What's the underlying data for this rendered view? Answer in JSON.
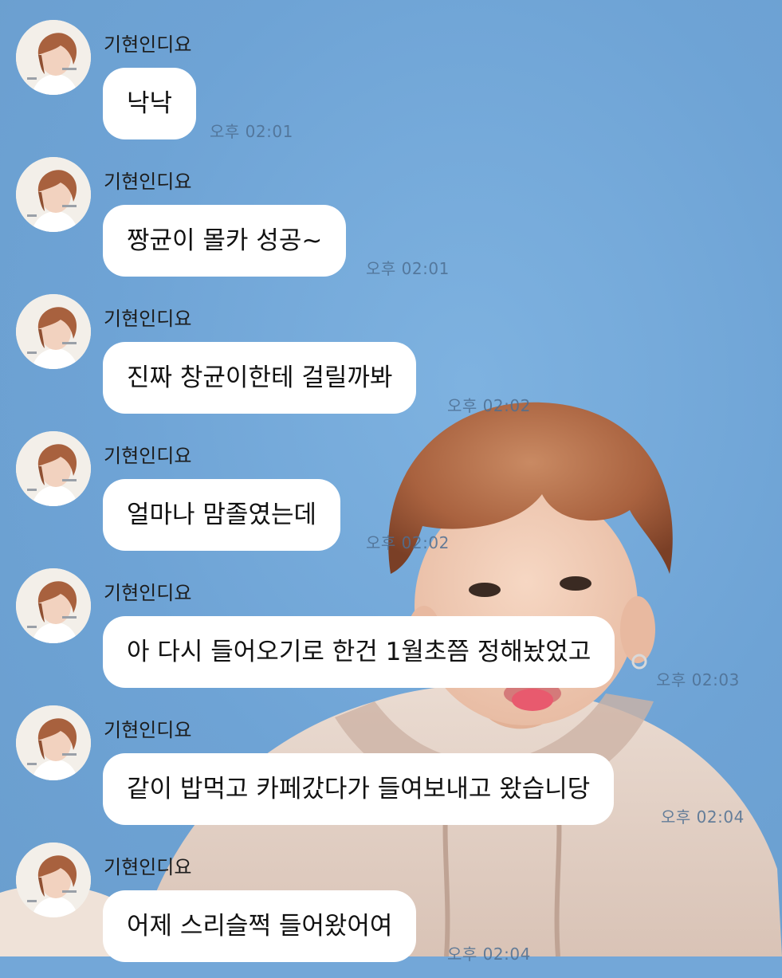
{
  "chat": {
    "messages": [
      {
        "sender": "기현인디요",
        "text": "낙낙",
        "time": "오후 02:01"
      },
      {
        "sender": "기현인디요",
        "text": "짱균이 몰카 성공~",
        "time": "오후 02:01"
      },
      {
        "sender": "기현인디요",
        "text": "진짜 창균이한테 걸릴까봐",
        "time": "오후 02:02"
      },
      {
        "sender": "기현인디요",
        "text": "얼마나 맘졸였는데",
        "time": "오후 02:02"
      },
      {
        "sender": "기현인디요",
        "text": "아 다시 들어오기로 한건 1월초쯤 정해놨었고",
        "time": "오후 02:03"
      },
      {
        "sender": "기현인디요",
        "text": "같이 밥먹고 카페갔다가 들여보내고 왔습니당",
        "time": "오후 02:04"
      },
      {
        "sender": "기현인디요",
        "text": "어제 스리슬쩍 들어왔어여",
        "time": "오후 02:04"
      }
    ]
  },
  "colors": {
    "wallpaper": "#73a7d8",
    "bubble": "#ffffff",
    "timestamp": "#4e6f92"
  }
}
